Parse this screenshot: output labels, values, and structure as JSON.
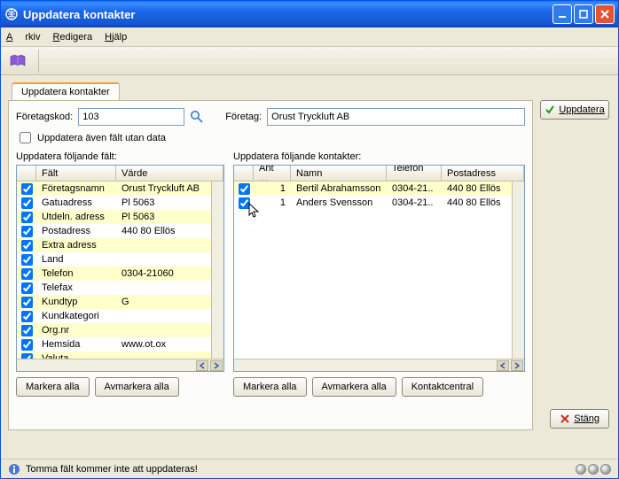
{
  "window": {
    "title": "Uppdatera kontakter"
  },
  "menu": {
    "arkiv": "Arkiv",
    "redigera": "Redigera",
    "hjalp": "Hjälp"
  },
  "tab": {
    "label": "Uppdatera kontakter"
  },
  "form": {
    "foretagskod_label": "Företagskod:",
    "foretagskod_value": "103",
    "foretag_label": "Företag:",
    "foretag_value": "Orust Tryckluft AB",
    "uppdatera_aven_label": "Uppdatera även fält utan data"
  },
  "fields_grid": {
    "title": "Uppdatera följande fält:",
    "cols": {
      "chk": "",
      "falt": "Fält",
      "varde": "Värde"
    },
    "rows": [
      {
        "checked": true,
        "falt": "Företagsnamn",
        "varde": "Orust Tryckluft AB"
      },
      {
        "checked": true,
        "falt": "Gatuadress",
        "varde": "Pl 5063"
      },
      {
        "checked": true,
        "falt": "Utdeln. adress",
        "varde": "Pl 5063"
      },
      {
        "checked": true,
        "falt": "Postadress",
        "varde": "440 80 Ellös"
      },
      {
        "checked": true,
        "falt": "Extra adress",
        "varde": ""
      },
      {
        "checked": true,
        "falt": "Land",
        "varde": ""
      },
      {
        "checked": true,
        "falt": "Telefon",
        "varde": "0304-21060"
      },
      {
        "checked": true,
        "falt": "Telefax",
        "varde": ""
      },
      {
        "checked": true,
        "falt": "Kundtyp",
        "varde": "G"
      },
      {
        "checked": true,
        "falt": "Kundkategori",
        "varde": ""
      },
      {
        "checked": true,
        "falt": "Org.nr",
        "varde": ""
      },
      {
        "checked": true,
        "falt": "Hemsida",
        "varde": "www.ot.ox"
      },
      {
        "checked": true,
        "falt": "Valuta",
        "varde": ""
      }
    ]
  },
  "contacts_grid": {
    "title": "Uppdatera följande kontakter:",
    "cols": {
      "chk": "",
      "ant": "Ant …",
      "namn": "Namn",
      "telefon": "Telefon …",
      "post": "Postadress"
    },
    "rows": [
      {
        "checked": true,
        "ant": "1",
        "namn": "Bertil Abrahamsson",
        "telefon": "0304-21..",
        "post": "440 80 Ellös"
      },
      {
        "checked": true,
        "ant": "1",
        "namn": "Anders Svensson",
        "telefon": "0304-21..",
        "post": "440 80 Ellös"
      }
    ]
  },
  "buttons": {
    "markera_alla": "Markera alla",
    "avmarkera_alla": "Avmarkera alla",
    "kontaktcentral": "Kontaktcentral",
    "uppdatera": "Uppdatera",
    "stang": "Stäng"
  },
  "status": {
    "text": "Tomma fält kommer inte att uppdateras!"
  }
}
